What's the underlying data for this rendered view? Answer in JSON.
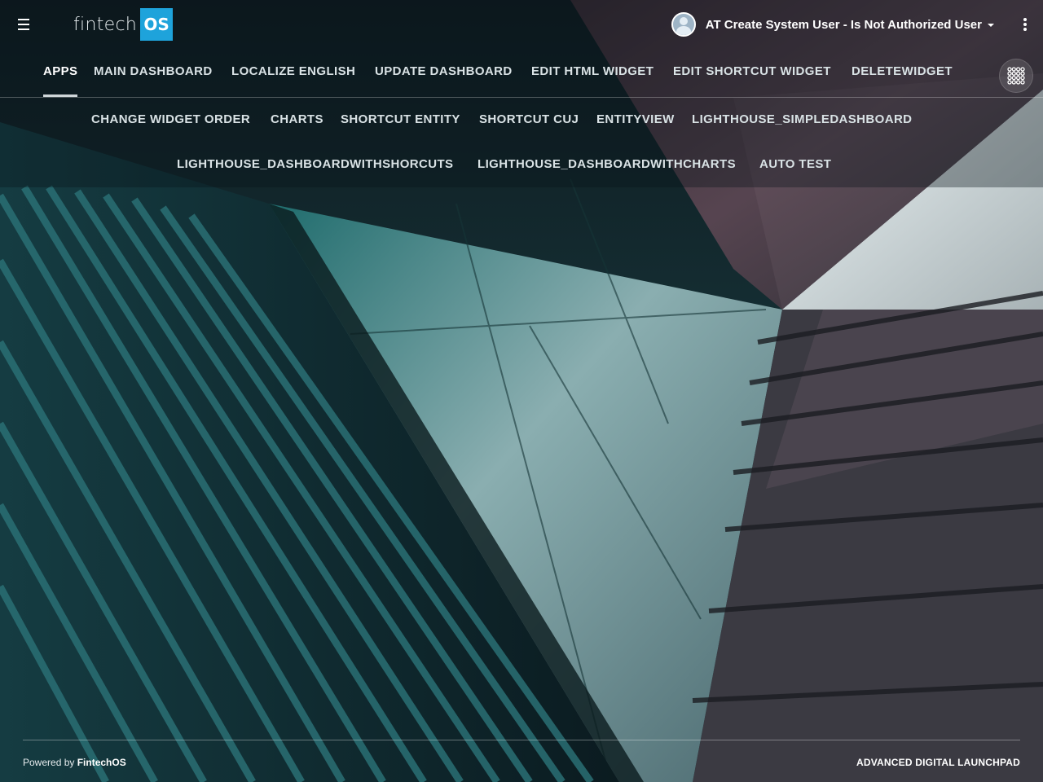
{
  "header": {
    "logo_text": "fintech",
    "logo_badge": "OS",
    "user_name": "AT Create System User - Is Not Authorized User",
    "menu_icon": "hamburger-icon",
    "more_icon": "kebab-menu-icon",
    "apps_icon": "apps-grid-icon"
  },
  "nav": {
    "row1": [
      {
        "label": "APPS",
        "active": true
      },
      {
        "label": "MAIN DASHBOARD"
      },
      {
        "label": "LOCALIZE ENGLISH"
      },
      {
        "label": "UPDATE DASHBOARD"
      },
      {
        "label": "EDIT HTML WIDGET"
      },
      {
        "label": "EDIT SHORTCUT WIDGET"
      },
      {
        "label": "DELETEWIDGET"
      }
    ],
    "row2": [
      {
        "label": "CHANGE WIDGET ORDER"
      },
      {
        "label": "CHARTS"
      },
      {
        "label": "SHORTCUT ENTITY"
      },
      {
        "label": "SHORTCUT CUJ"
      },
      {
        "label": "ENTITYVIEW"
      },
      {
        "label": "LIGHTHOUSE_SIMPLEDASHBOARD"
      }
    ],
    "row3": [
      {
        "label": "LIGHTHOUSE_DASHBOARDWITHSHORCUTS"
      },
      {
        "label": "LIGHTHOUSE_DASHBOARDWITHCHARTS"
      },
      {
        "label": "AUTO TEST"
      }
    ]
  },
  "footer": {
    "powered_prefix": "Powered by",
    "powered_brand": "FintechOS",
    "launchpad": "ADVANCED DIGITAL LAUNCHPAD"
  },
  "colors": {
    "brand_blue": "#1ea3db",
    "active_underline": "#cfd6d9"
  }
}
